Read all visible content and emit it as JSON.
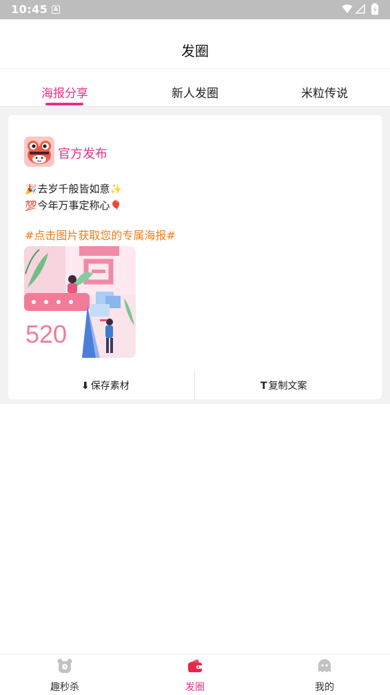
{
  "status_bar": {
    "time": "10:45",
    "badge": "A"
  },
  "header": {
    "title": "发圈"
  },
  "tabs": [
    {
      "label": "海报分享",
      "active": true
    },
    {
      "label": "新人发圈",
      "active": false
    },
    {
      "label": "米粒传说",
      "active": false
    }
  ],
  "post": {
    "author": "官方发布",
    "line1_emoji": "🎉",
    "line1_text": "去岁千般皆如意",
    "line1_tail": "✨",
    "line2_emoji": "💯",
    "line2_text": "今年万事定称心",
    "line2_tail": "🎈",
    "hashtag": "#点击图片获取您的专属海报#",
    "poster_number": "520"
  },
  "actions": {
    "save_label": "保存素材",
    "copy_label": "复制文案",
    "save_icon": "⬇",
    "copy_icon": "T"
  },
  "bottom_nav": [
    {
      "label": "趣秒杀",
      "icon": "bear-icon",
      "active": false
    },
    {
      "label": "发圈",
      "icon": "wallet-icon",
      "active": true
    },
    {
      "label": "我的",
      "icon": "ghost-icon",
      "active": false
    }
  ],
  "colors": {
    "accent": "#e4328a",
    "hashtag": "#f07d1a",
    "status_bar": "#bdbdbd"
  }
}
